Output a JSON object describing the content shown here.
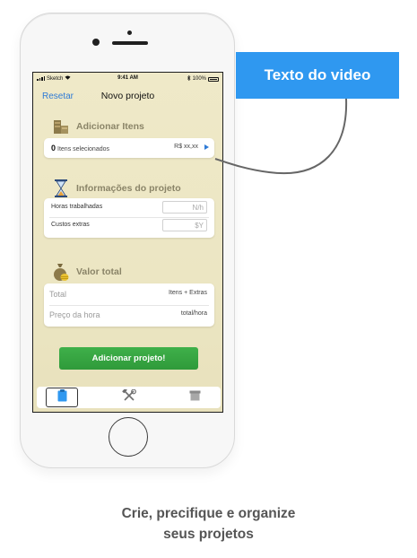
{
  "statusbar": {
    "carrier": "Sketch",
    "time": "9:41 AM",
    "battery": "100%"
  },
  "nav": {
    "reset": "Resetar",
    "title": "Novo projeto"
  },
  "items_section": {
    "title": "Adicionar Itens",
    "count": "0",
    "count_label": "Itens selecionados",
    "price": "R$ xx,xx"
  },
  "info_section": {
    "title": "Informações do projeto",
    "hours_label": "Horas trabalhadas",
    "hours_placeholder": "N/h",
    "extras_label": "Custos extras",
    "extras_placeholder": "$Y"
  },
  "total_section": {
    "title": "Valor total",
    "total_label": "Total",
    "total_value": "Itens + Extras",
    "hour_price_label": "Preço da hora",
    "hour_price_value": "total/hora"
  },
  "add_button": "Adicionar projeto!",
  "tabs": [
    {
      "icon": "clipboard-icon",
      "active": true
    },
    {
      "icon": "tools-icon",
      "active": false
    },
    {
      "icon": "archive-icon",
      "active": false
    }
  ],
  "callout": "Texto do video",
  "caption": {
    "line1": "Crie, precifique e organize",
    "line2": "seus projetos"
  },
  "colors": {
    "accent": "#2f7bd6",
    "callout": "#2f98f0",
    "button": "#3aa845",
    "screen_bg": "#ece6c3"
  }
}
